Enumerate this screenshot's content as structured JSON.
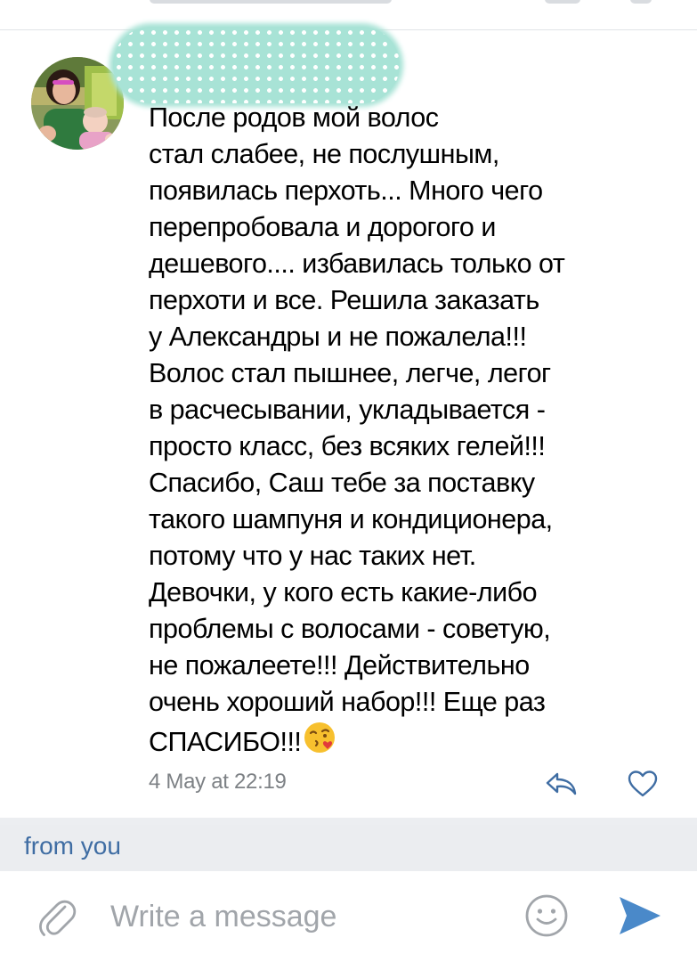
{
  "message": {
    "lines": [
      "После родов мой волос",
      "стал слабее, не послушным,",
      "появилась перхоть... Много чего",
      "перепробовала и дорогого и",
      "дешевого.... избавилась только от",
      "перхоти и все. Решила заказать",
      "у Александры и не пожалела!!!",
      "Волос стал пышнее, легче, легог",
      "в расчесывании, укладывается -",
      "просто класс, без всяких гелей!!!",
      "Спасибо, Саш тебе за поставку",
      "такого шампуня и кондиционера,",
      "потому что у нас таких нет.",
      "Девочки, у кого есть какие-либо",
      "проблемы с волосами - советую,",
      "не пожалеете!!! Действительно",
      "очень хороший набор!!! Еще раз",
      "СПАСИБО!!!"
    ],
    "trailing_emoji_icon": "face-blowing-kiss-emoji",
    "timestamp": "4 May at 22:19",
    "sender_avatar": "sender-avatar-photo",
    "reply_icon": "reply-arrow-icon",
    "like_icon": "heart-outline-icon"
  },
  "footer": {
    "from_label": "from you"
  },
  "composer": {
    "placeholder": "Write a message",
    "value": "",
    "attach_icon": "paperclip-icon",
    "emoji_icon": "smiley-face-icon",
    "send_icon": "send-arrow-icon"
  },
  "colors": {
    "accent": "#3f6da3",
    "send": "#4a89c9",
    "timestamp": "#7d8185",
    "placeholder": "#a1a5aa",
    "censor_overlay": "#a8e3d6",
    "from_bar_bg": "#ebedf0"
  }
}
